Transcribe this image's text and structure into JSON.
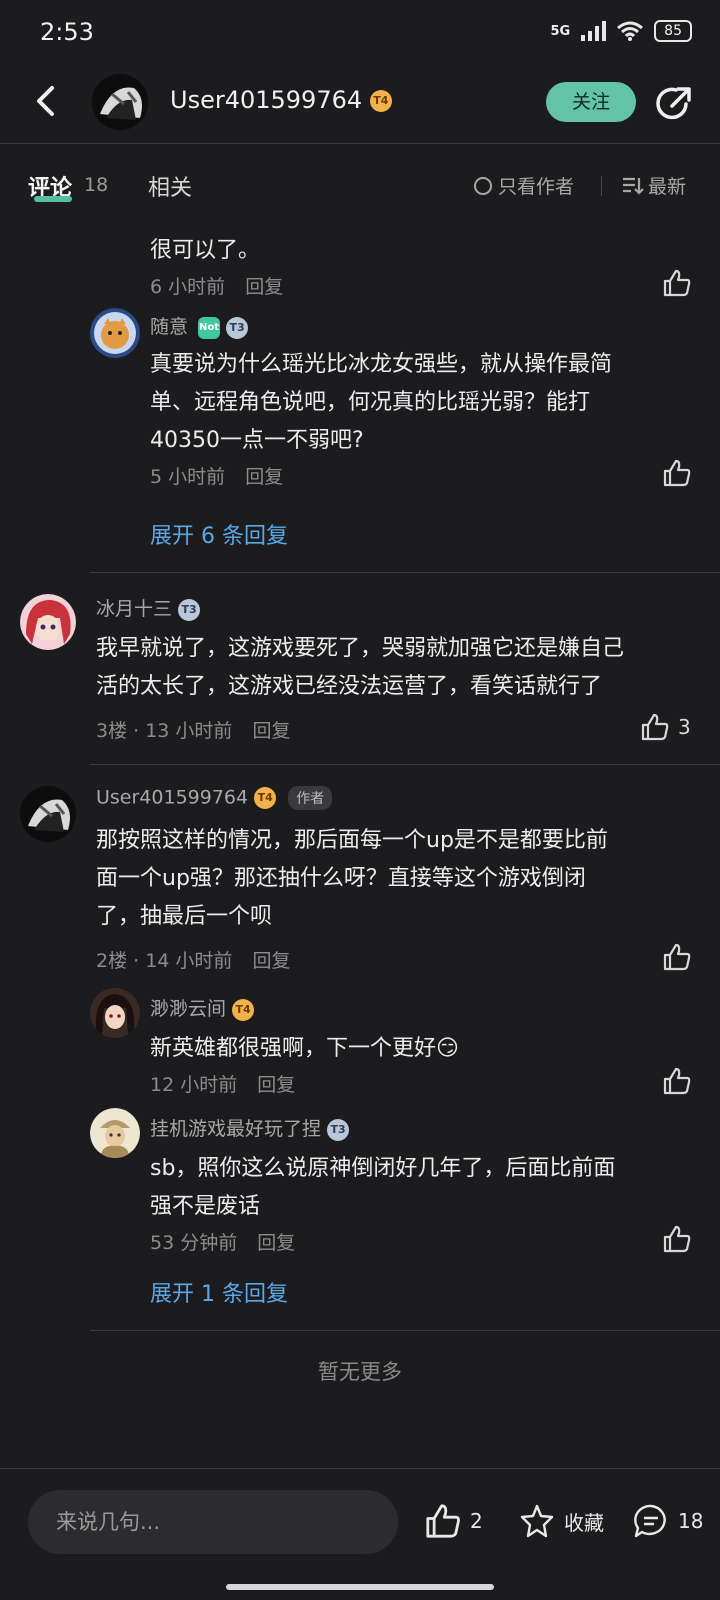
{
  "status": {
    "time": "2:53",
    "network": "5G",
    "battery": "85"
  },
  "header": {
    "username": "User401599764",
    "level_badge": "T4",
    "follow_label": "关注"
  },
  "tabs": {
    "comment_label": "评论",
    "comment_count": "18",
    "related_label": "相关",
    "only_author_label": "只看作者",
    "sort_label": "最新"
  },
  "comments": {
    "top_partial": {
      "text": "很可以了。",
      "meta": "6 小时前",
      "reply_label": "回复"
    },
    "reply_1": {
      "name": "随意",
      "badge_not": "Not",
      "level_badge": "T3",
      "text_line1": "真要说为什么瑶光比冰龙女强些，就从操作最简",
      "text_line2": "单、远程角色说吧，何况真的比瑶光弱？能打",
      "text_line3": "40350一点一不弱吧?",
      "meta": "5 小时前",
      "reply_label": "回复"
    },
    "expand_1": "展开 6 条回复",
    "floor3": {
      "name": "冰月十三",
      "level_badge": "T3",
      "text_line1": "我早就说了，这游戏要死了，哭弱就加强它还是嫌自己",
      "text_line2": "活的太长了，这游戏已经没法运营了，看笑话就行了",
      "meta": "3楼 · 13 小时前",
      "reply_label": "回复",
      "likes": "3"
    },
    "floor2": {
      "name": "User401599764",
      "level_badge": "T4",
      "author_tag": "作者",
      "text_line1": "那按照这样的情况，那后面每一个up是不是都要比前",
      "text_line2": "面一个up强？那还抽什么呀？直接等这个游戏倒闭",
      "text_line3": "了，抽最后一个呗",
      "meta": "2楼 · 14 小时前",
      "reply_label": "回复"
    },
    "reply_2": {
      "name": "渺渺云间",
      "level_badge": "T4",
      "text": "新英雄都很强啊，下一个更好😏",
      "meta": "12 小时前",
      "reply_label": "回复"
    },
    "reply_3": {
      "name": "挂机游戏最好玩了捏",
      "level_badge": "T3",
      "text_line1": "sb，照你这么说原神倒闭好几年了，后面比前面",
      "text_line2": "强不是废话",
      "meta": "53 分钟前",
      "reply_label": "回复"
    },
    "expand_2": "展开 1 条回复"
  },
  "no_more": "暂无更多",
  "bottom": {
    "input_placeholder": "来说几句...",
    "like_count": "2",
    "favorite_label": "收藏",
    "comment_count": "18"
  },
  "colors": {
    "accent": "#62c3a6",
    "link": "#5aa8e8",
    "background": "#1c1c1e"
  }
}
